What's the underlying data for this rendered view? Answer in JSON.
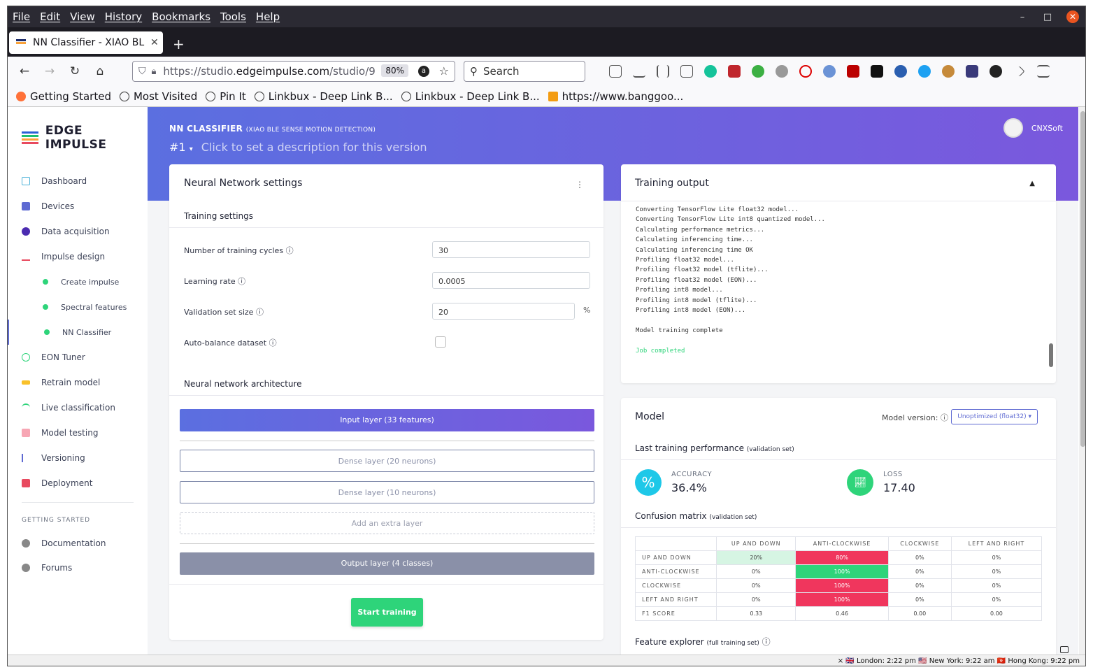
{
  "browser": {
    "menu": [
      "File",
      "Edit",
      "View",
      "History",
      "Bookmarks",
      "Tools",
      "Help"
    ],
    "tab_title": "NN Classifier - XIAO BLE S",
    "url_prefix": "https://studio.",
    "url_domain": "edgeimpulse.com",
    "url_path": "/studio/9",
    "zoom": "80%",
    "search_placeholder": "Search",
    "bookmarks": [
      "Getting Started",
      "Most Visited",
      "Pin It",
      "Linkbux - Deep Link B...",
      "Linkbux - Deep Link B...",
      "https://www.banggoo..."
    ],
    "status": "× 🇬🇧 London: 2:22 pm   🇺🇸 New York: 9:22 am   🇭🇰 Hong Kong: 9:22 pm"
  },
  "sidebar": {
    "logo": "EDGE IMPULSE",
    "items": [
      {
        "label": "Dashboard",
        "color": "#4fb3d9"
      },
      {
        "label": "Devices",
        "color": "#5e6ad2"
      },
      {
        "label": "Data acquisition",
        "color": "#4b2bb0"
      },
      {
        "label": "Impulse design",
        "color": "#e84a5f"
      },
      {
        "label": "Create impulse"
      },
      {
        "label": "Spectral features"
      },
      {
        "label": "NN Classifier"
      },
      {
        "label": "EON Tuner",
        "color": "#2ed47a"
      },
      {
        "label": "Retrain model",
        "color": "#f9c12a"
      },
      {
        "label": "Live classification",
        "color": "#2ed47a"
      },
      {
        "label": "Model testing",
        "color": "#e84a5f"
      },
      {
        "label": "Versioning",
        "color": "#5e6ad2"
      },
      {
        "label": "Deployment",
        "color": "#e84a5f"
      }
    ],
    "getting_started": "GETTING STARTED",
    "gs_items": [
      {
        "label": "Documentation"
      },
      {
        "label": "Forums"
      }
    ]
  },
  "header": {
    "title": "NN CLASSIFIER",
    "subtitle": "(XIAO BLE SENSE MOTION DETECTION)",
    "version": "#1",
    "description": "Click to set a description for this version",
    "user": "CNXSoft"
  },
  "nn_settings": {
    "title": "Neural Network settings",
    "training_settings": "Training settings",
    "cycles_label": "Number of training cycles",
    "cycles_value": "30",
    "lr_label": "Learning rate",
    "lr_value": "0.0005",
    "val_label": "Validation set size",
    "val_value": "20",
    "val_unit": "%",
    "autobalance_label": "Auto-balance dataset",
    "arch_title": "Neural network architecture",
    "input_layer": "Input layer (33 features)",
    "dense1": "Dense layer (20 neurons)",
    "dense2": "Dense layer (10 neurons)",
    "add_layer": "Add an extra layer",
    "output_layer": "Output layer (4 classes)",
    "start_training": "Start training"
  },
  "training_output": {
    "title": "Training output",
    "lines": [
      "Converting TensorFlow Lite float32 model...",
      "Converting TensorFlow Lite int8 quantized model...",
      "Calculating performance metrics...",
      "Calculating inferencing time...",
      "Calculating inferencing time OK",
      "Profiling float32 model...",
      "Profiling float32 model (tflite)...",
      "Profiling float32 model (EON)...",
      "Profiling int8 model...",
      "Profiling int8 model (tflite)...",
      "Profiling int8 model (EON)...",
      "",
      "Model training complete",
      ""
    ],
    "job_done": "Job completed"
  },
  "model": {
    "title": "Model",
    "version_label": "Model version:",
    "version_value": "Unoptimized (float32)",
    "perf_title": "Last training performance",
    "perf_note": "(validation set)",
    "accuracy_label": "ACCURACY",
    "accuracy_value": "36.4%",
    "loss_label": "LOSS",
    "loss_value": "17.40",
    "cm_title": "Confusion matrix",
    "cm_note": "(validation set)",
    "cm_columns": [
      "UP AND DOWN",
      "ANTI-CLOCKWISE",
      "CLOCKWISE",
      "LEFT AND RIGHT"
    ],
    "cm_rows": [
      {
        "label": "UP AND DOWN",
        "cells": [
          "20%",
          "80%",
          "0%",
          "0%"
        ]
      },
      {
        "label": "ANTI-CLOCKWISE",
        "cells": [
          "0%",
          "100%",
          "0%",
          "0%"
        ]
      },
      {
        "label": "CLOCKWISE",
        "cells": [
          "0%",
          "100%",
          "0%",
          "0%"
        ]
      },
      {
        "label": "LEFT AND RIGHT",
        "cells": [
          "0%",
          "100%",
          "0%",
          "0%"
        ]
      }
    ],
    "f1_label": "F1 SCORE",
    "f1_values": [
      "0.33",
      "0.46",
      "0.00",
      "0.00"
    ],
    "fe_title": "Feature explorer",
    "fe_note": "(full training set)"
  },
  "colors": {
    "accent": "#5e6ad2",
    "good": "#2ed47a",
    "bad": "#f0365d",
    "goodlight": "#d6f5e3"
  }
}
